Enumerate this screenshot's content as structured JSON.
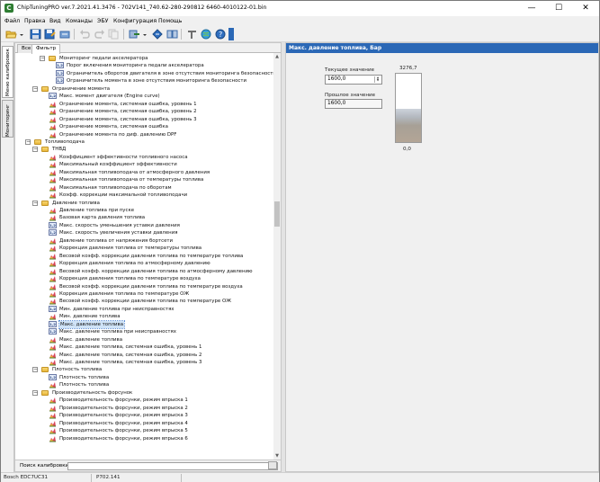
{
  "window": {
    "title": "ChipTuningPRO ver.7.2021.41.3476 - 702V141_740.62-280-290812 6460-4010122-01.bin",
    "app_icon": "chiptuning-logo-icon",
    "min_glyph": "—",
    "max_glyph": "☐",
    "close_glyph": "✕"
  },
  "menu": [
    "Файл",
    "Правка",
    "Вид",
    "Команды",
    "ЭБУ",
    "Конфигурация",
    "Помощь"
  ],
  "toolbar": {
    "icons": [
      "open-folder-icon",
      "save-icon",
      "save-as-icon",
      "refresh-icon",
      "undo-icon",
      "redo-icon",
      "copy-icon",
      "checksum-icon",
      "compare-icon",
      "diamond-icon",
      "search-icon",
      "tools-icon",
      "globe-icon",
      "help-icon",
      "overflow-icon"
    ]
  },
  "side_tabs": {
    "calibrations": "Меню калибровок",
    "monitoring": "Мониторинг"
  },
  "filter_tabs": {
    "all": "Все",
    "filter": "Фильтр"
  },
  "tree": [
    {
      "level": 3,
      "type": "folder",
      "expand": "−",
      "label": "Мониторинг педали акселератора"
    },
    {
      "level": 4,
      "type": "2d",
      "label": "Порог включения мониторинга педали акселератора"
    },
    {
      "level": 4,
      "type": "2d",
      "label": "Ограничитель оборотов двигателя в зоне отсутствия мониторинга безопасности"
    },
    {
      "level": 4,
      "type": "2d",
      "label": "Ограничитель момента в зоне отсутствия мониторинга безопасности"
    },
    {
      "level": 2,
      "type": "folder",
      "expand": "−",
      "label": "Ограничение момента"
    },
    {
      "level": 3,
      "type": "2d",
      "label": "Макс. момент двигателя (Engine curve)"
    },
    {
      "level": 3,
      "type": "3d",
      "label": "Ограничение момента, системная ошибка, уровень 1"
    },
    {
      "level": 3,
      "type": "3d",
      "label": "Ограничение момента, системная ошибка, уровень 2"
    },
    {
      "level": 3,
      "type": "3d",
      "label": "Ограничение момента, системная ошибка, уровень 3"
    },
    {
      "level": 3,
      "type": "3d",
      "label": "Ограничение момента, системная ошибка"
    },
    {
      "level": 3,
      "type": "3d",
      "label": "Ограничение момента по диф. давлению DPF"
    },
    {
      "level": 1,
      "type": "folder",
      "expand": "−",
      "label": "Топливоподача"
    },
    {
      "level": 2,
      "type": "folder",
      "expand": "−",
      "label": "ТНВД"
    },
    {
      "level": 3,
      "type": "3d",
      "label": "Коэффициент эффективности топливного насоса"
    },
    {
      "level": 3,
      "type": "3d",
      "label": "Максимальный коэффициент эффективности"
    },
    {
      "level": 3,
      "type": "3d",
      "label": "Максимальная топливоподача от атмосферного давления"
    },
    {
      "level": 3,
      "type": "3d",
      "label": "Максимальная топливоподача от температуры топлива"
    },
    {
      "level": 3,
      "type": "3d",
      "label": "Максимальная топливоподача по оборотам"
    },
    {
      "level": 3,
      "type": "3d",
      "label": "Коэфф. коррекции максимальной топливоподачи"
    },
    {
      "level": 2,
      "type": "folder",
      "expand": "−",
      "label": "Давление топлива"
    },
    {
      "level": 3,
      "type": "3d",
      "label": "Давление топлива при пуске"
    },
    {
      "level": 3,
      "type": "3d",
      "label": "Базовая карта давления топлива"
    },
    {
      "level": 3,
      "type": "2d",
      "label": "Макс. скорость уменьшения уставки давления"
    },
    {
      "level": 3,
      "type": "2d",
      "label": "Макс. скорость увеличения уставки давления"
    },
    {
      "level": 3,
      "type": "3d",
      "label": "Давление топлива от напряжения бортсети"
    },
    {
      "level": 3,
      "type": "3d",
      "label": "Коррекция давления топлива от температуры топлива"
    },
    {
      "level": 3,
      "type": "3d",
      "label": "Весовой коэфф. коррекции давления топлива по температуре топлива"
    },
    {
      "level": 3,
      "type": "3d",
      "label": "Коррекция давления топлива по атмосферному давлению"
    },
    {
      "level": 3,
      "type": "3d",
      "label": "Весовой коэфф. коррекции давления топлива по атмосферному давлению"
    },
    {
      "level": 3,
      "type": "3d",
      "label": "Коррекция давления топлива по температуре воздуха"
    },
    {
      "level": 3,
      "type": "3d",
      "label": "Весовой коэфф. коррекции давления топлива по температуре воздуха"
    },
    {
      "level": 3,
      "type": "3d",
      "label": "Коррекция давления топлива по температуре ОЖ"
    },
    {
      "level": 3,
      "type": "3d",
      "label": "Весовой коэфф. коррекции давления топлива по температуре ОЖ"
    },
    {
      "level": 3,
      "type": "2d",
      "label": "Мин. давление топлива при неисправностях"
    },
    {
      "level": 3,
      "type": "3d",
      "label": "Мин. давление топлива"
    },
    {
      "level": 3,
      "type": "2d",
      "label": "Макс. давление топлива",
      "selected": true
    },
    {
      "level": 3,
      "type": "2d",
      "label": "Макс. давление топлива при неисправностях"
    },
    {
      "level": 3,
      "type": "3d",
      "label": "Макс. давление топлива"
    },
    {
      "level": 3,
      "type": "3d",
      "label": "Макс. давление топлива, системная ошибка, уровень 1"
    },
    {
      "level": 3,
      "type": "3d",
      "label": "Макс. давление топлива, системная ошибка, уровень 2"
    },
    {
      "level": 3,
      "type": "3d",
      "label": "Макс. давление топлива, системная ошибка, уровень 3"
    },
    {
      "level": 2,
      "type": "folder",
      "expand": "−",
      "label": "Плотность топлива"
    },
    {
      "level": 3,
      "type": "2d",
      "label": "Плотность топлива"
    },
    {
      "level": 3,
      "type": "3d",
      "label": "Плотность топлива"
    },
    {
      "level": 2,
      "type": "folder",
      "expand": "−",
      "label": "Производительность форсунок"
    },
    {
      "level": 3,
      "type": "3d",
      "label": "Производительность форсунки, режим впрыска 1"
    },
    {
      "level": 3,
      "type": "3d",
      "label": "Производительность форсунки, режим впрыска 2"
    },
    {
      "level": 3,
      "type": "3d",
      "label": "Производительность форсунки, режим впрыска 3"
    },
    {
      "level": 3,
      "type": "3d",
      "label": "Производительность форсунки, режим впрыска 4"
    },
    {
      "level": 3,
      "type": "3d",
      "label": "Производительность форсунки, режим впрыска 5"
    },
    {
      "level": 3,
      "type": "3d",
      "label": "Производительность форсунки, режим впрыска 6"
    }
  ],
  "search": {
    "label": "Поиск калибровки",
    "value": ""
  },
  "detail": {
    "header": "Макс. давление топлива, Бар",
    "current_label": "Текущее значение",
    "current_value": "1600,0",
    "previous_label": "Прошлое значение",
    "previous_value": "1600,0",
    "gauge_max": "3276,7",
    "gauge_min": "0,0",
    "gauge_level": 0.49
  },
  "status": {
    "ecu": "Bosch EDC7UC31",
    "part": "P702.141"
  }
}
